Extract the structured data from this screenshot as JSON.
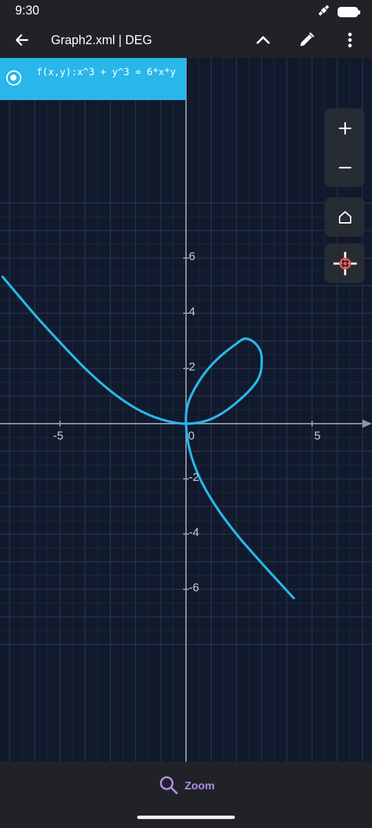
{
  "status_bar": {
    "time": "9:30"
  },
  "app_bar": {
    "back_icon": "arrow-left-icon",
    "title": "Graph2.xml | DEG",
    "collapse_icon": "chevron-up-icon",
    "edit_icon": "pencil-icon",
    "menu_icon": "more-vert-icon"
  },
  "function": {
    "expression": "f(x,y):x^3 + y^3 = 6*x*y",
    "color": "#29b6ea",
    "selected": true
  },
  "controls": {
    "zoom_in_icon": "plus-icon",
    "zoom_out_icon": "minus-icon",
    "home_icon": "home-icon",
    "trace_icon": "crosshair-icon"
  },
  "bottom_bar": {
    "zoom_label": "Zoom",
    "zoom_icon": "search-icon"
  },
  "chart_data": {
    "type": "line",
    "title": "",
    "xlabel": "",
    "ylabel": "",
    "xlim": [
      -7.3,
      7.3
    ],
    "ylim": [
      -6.2,
      6.6
    ],
    "grid": true,
    "x_ticks": [
      {
        "value": -5,
        "label": "-5"
      },
      {
        "value": 0,
        "label": "0"
      },
      {
        "value": 5,
        "label": "5"
      }
    ],
    "y_ticks": [
      {
        "value": 6,
        "label": "6"
      },
      {
        "value": 4,
        "label": "4"
      },
      {
        "value": 2,
        "label": "2"
      },
      {
        "value": -2,
        "label": "-2"
      },
      {
        "value": -4,
        "label": "-4"
      },
      {
        "value": -6,
        "label": "-6"
      }
    ],
    "series": [
      {
        "name": "f(x,y):x^3 + y^3 = 6*x*y",
        "color": "#29b6ea",
        "curve": "folium of Descartes",
        "points": [
          [
            -7.3,
            5.35
          ],
          [
            -6.0,
            3.95
          ],
          [
            -5.0,
            2.95
          ],
          [
            -4.0,
            2.0
          ],
          [
            -3.0,
            1.19
          ],
          [
            -2.0,
            0.56
          ],
          [
            -1.0,
            0.16
          ],
          [
            0.0,
            0.0
          ],
          [
            1.0,
            0.17
          ],
          [
            2.0,
            0.76
          ],
          [
            2.85,
            1.6
          ],
          [
            3.0,
            2.4
          ],
          [
            2.8,
            2.86
          ],
          [
            2.38,
            3.08
          ],
          [
            2.0,
            2.9
          ],
          [
            1.2,
            2.3
          ],
          [
            0.6,
            1.65
          ],
          [
            0.1,
            0.78
          ],
          [
            0.0,
            0.0
          ],
          [
            0.16,
            -1.0
          ],
          [
            0.56,
            -2.0
          ],
          [
            1.19,
            -3.0
          ],
          [
            2.0,
            -4.0
          ],
          [
            2.95,
            -5.0
          ],
          [
            3.95,
            -6.0
          ],
          [
            4.3,
            -6.35
          ]
        ]
      }
    ]
  }
}
